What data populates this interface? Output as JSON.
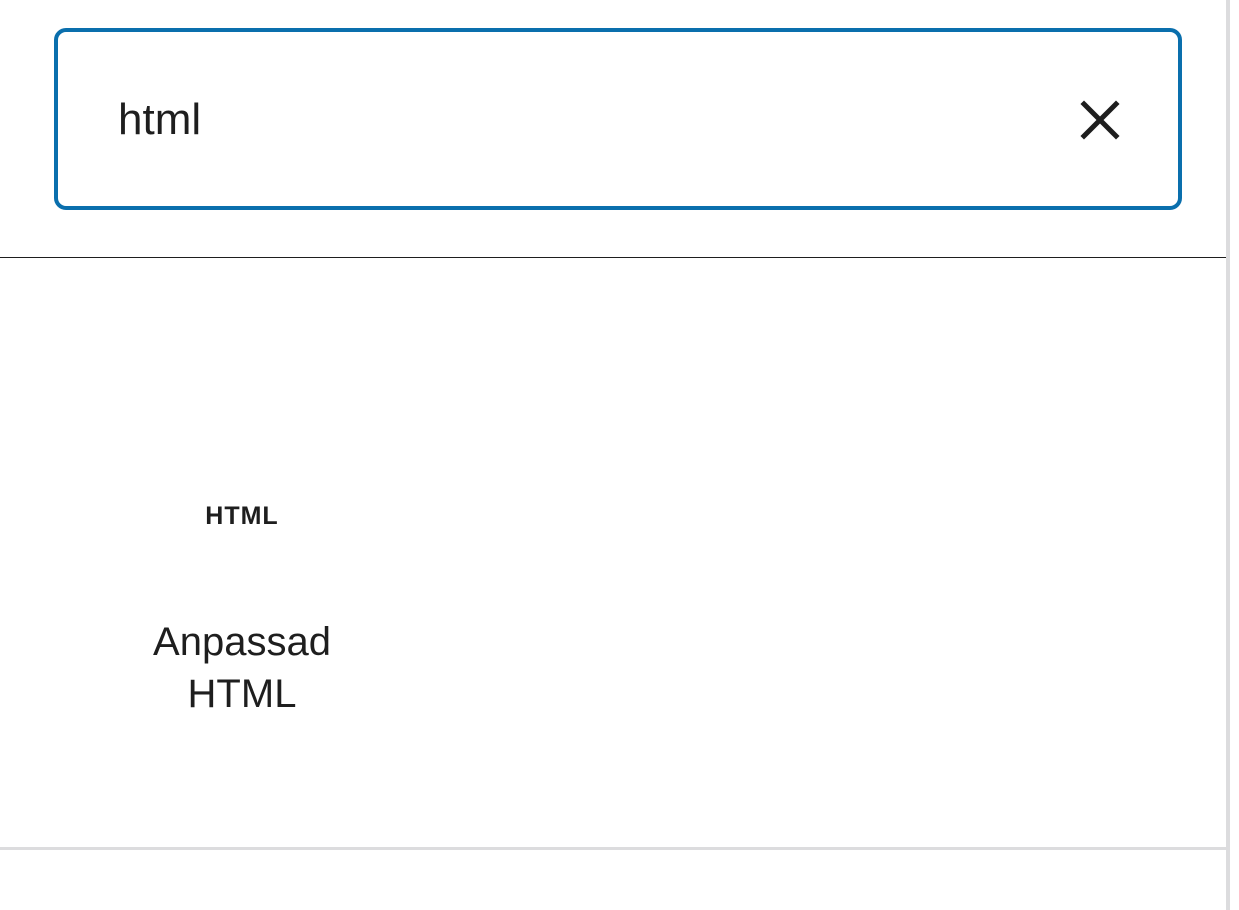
{
  "search": {
    "value": "html",
    "clear_icon": "close-icon"
  },
  "results": {
    "items": [
      {
        "icon_text": "HTML",
        "label": "Anpassad HTML"
      }
    ]
  },
  "colors": {
    "focus_border": "#0a6fad",
    "text": "#1e1e1e",
    "border_light": "#dcdcde"
  }
}
